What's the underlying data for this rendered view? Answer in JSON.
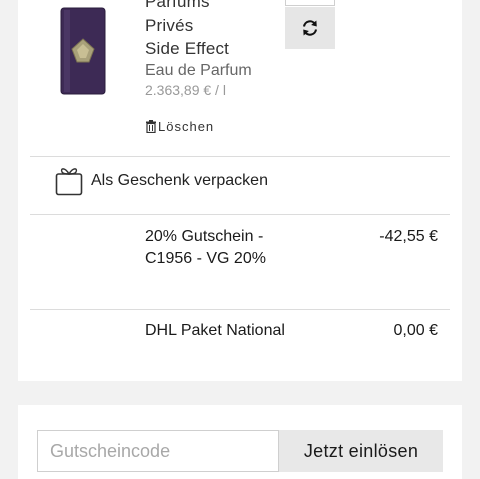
{
  "cart_item": {
    "brand_line1": "Parfums",
    "brand_line2": "Privés",
    "name": "Side Effect",
    "variant": "Eau de Parfum",
    "unit_price": "2.363,89 € / l",
    "delete_label": "Löschen",
    "image_icon": "perfume-bottle-icon",
    "refresh_icon": "refresh-icon"
  },
  "gift": {
    "label": "Als Geschenk verpacken",
    "icon": "gift-icon"
  },
  "voucher_line": {
    "name": "20% Gutschein - C1956 - VG 20%",
    "amount": "-42,55 €"
  },
  "shipping_line": {
    "name": "DHL Paket National",
    "amount": "0,00 €"
  },
  "voucher_form": {
    "placeholder": "Gutscheincode",
    "button_label": "Jetzt einlösen"
  },
  "colors": {
    "bottle": "#3b2a52",
    "button_bg": "#e6e6e6",
    "page_bg": "#f2f2f2"
  }
}
